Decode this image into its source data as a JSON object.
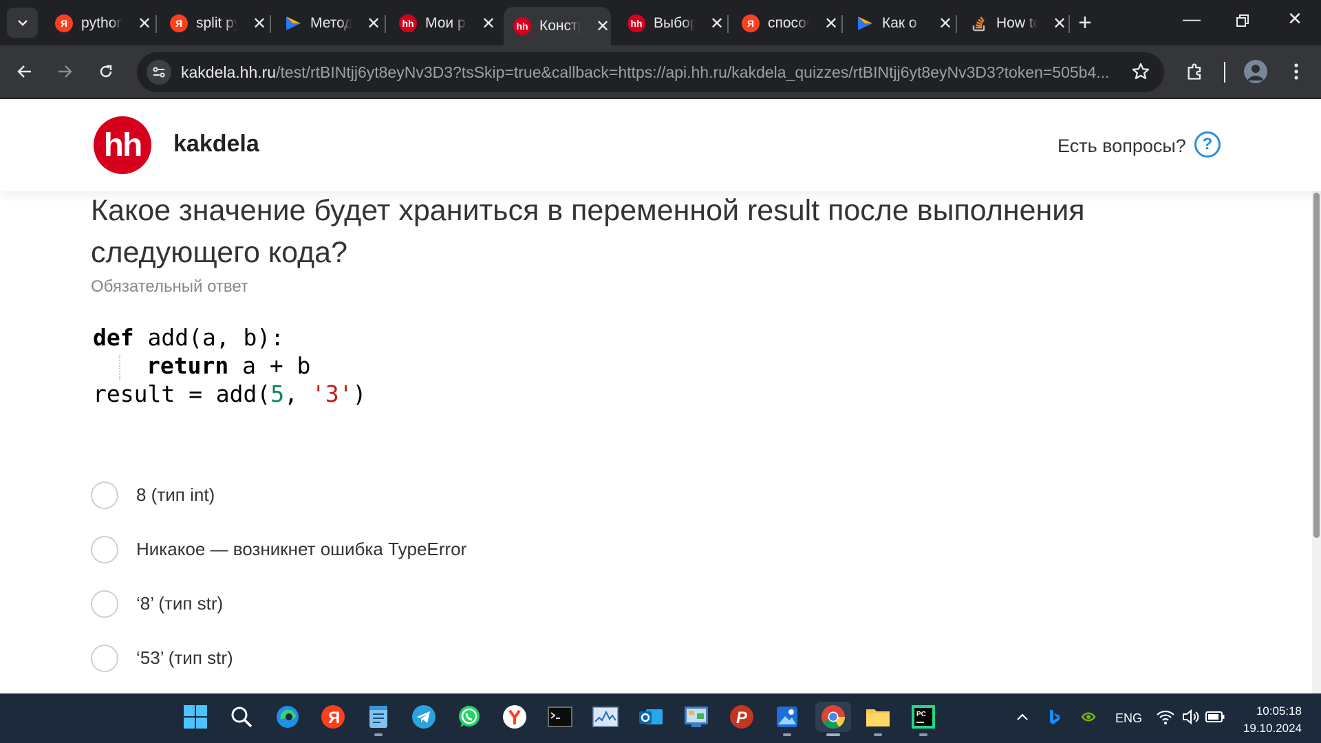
{
  "browser": {
    "tabs": [
      {
        "title": "python",
        "favicon": "yandex-icon",
        "color": "#fc3f1d",
        "active": false
      },
      {
        "title": "split python",
        "favicon": "yandex-icon",
        "color": "#fc3f1d",
        "active": false
      },
      {
        "title": "Методы",
        "favicon": "play-icon",
        "color": "#2b76ff",
        "active": false
      },
      {
        "title": "Мои резюме",
        "favicon": "hh-icon",
        "color": "#d6001c",
        "active": false
      },
      {
        "title": "Конструктор",
        "favicon": "hh-icon",
        "color": "#d6001c",
        "active": true
      },
      {
        "title": "Выбор",
        "favicon": "hh-icon",
        "color": "#d6001c",
        "active": false
      },
      {
        "title": "способ",
        "favicon": "yandex-icon",
        "color": "#fc3f1d",
        "active": false
      },
      {
        "title": "Как о",
        "favicon": "play-icon",
        "color": "#2b76ff",
        "active": false
      },
      {
        "title": "How to",
        "favicon": "stackoverflow-icon",
        "color": "#f48024",
        "active": false
      }
    ],
    "url_host": "kakdela.hh.ru",
    "url_path": "/test/rtBINtjj6yt8eyNv3D3?tsSkip=true&callback=https://api.hh.ru/kakdela_quizzes/rtBINtjj6yt8eyNv3D3?token=505b4..."
  },
  "site": {
    "logo_text": "hh",
    "brand": "kakdela",
    "help_text": "Есть вопросы?",
    "help_icon": "?"
  },
  "question": {
    "text": "Какое значение будет храниться в переменной result после выполнения следующего кода?",
    "required": "Обязательный ответ",
    "code": {
      "l1_kw": "def",
      "l1_rest": " add(a, b):",
      "l2_kw": "return",
      "l2_rest": " a + b",
      "l3_a": "result = add(",
      "l3_num": "5",
      "l3_b": ", ",
      "l3_str": "'3'",
      "l3_c": ")"
    },
    "options": [
      "8 (тип int)",
      "Никакое — возникнет ошибка TypeError",
      "‘8’ (тип str)",
      "‘53’ (тип str)"
    ]
  },
  "system": {
    "lang": "ENG",
    "time": "10:05:18",
    "date": "19.10.2024"
  }
}
